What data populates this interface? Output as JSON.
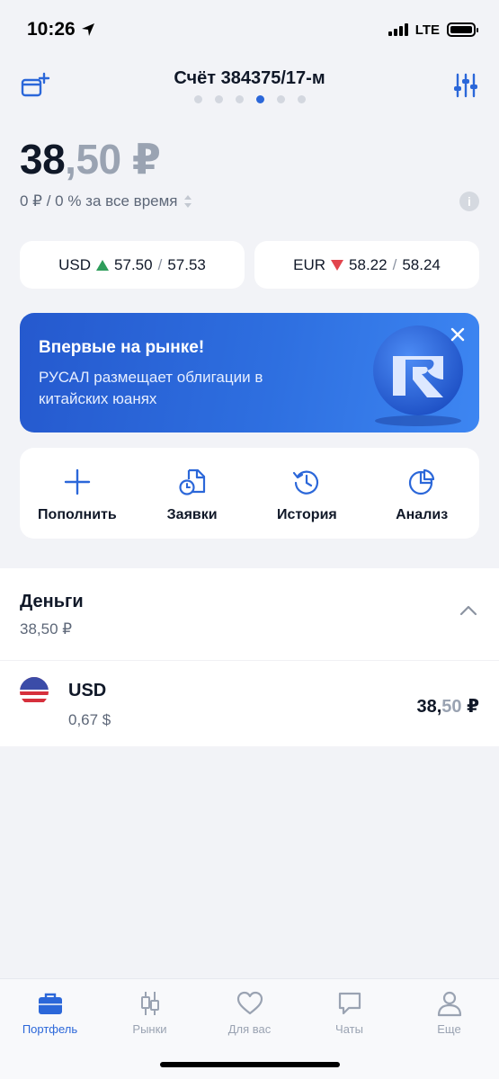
{
  "status": {
    "time": "10:26",
    "network": "LTE"
  },
  "header": {
    "title": "Счёт 384375/17-м",
    "pages": 6,
    "active_page": 3
  },
  "balance": {
    "integer": "38",
    "fraction": ",50 ₽",
    "change": "0 ₽ / 0 % за все время"
  },
  "rates": [
    {
      "currency": "USD",
      "direction": "up",
      "bid": "57.50",
      "ask": "57.53"
    },
    {
      "currency": "EUR",
      "direction": "down",
      "bid": "58.22",
      "ask": "58.24"
    }
  ],
  "banner": {
    "title": "Впервые на рынке!",
    "text": "РУСАЛ размещает облигации в китайских юанях"
  },
  "actions": [
    {
      "label": "Пополнить",
      "icon": "plus-icon"
    },
    {
      "label": "Заявки",
      "icon": "orders-icon"
    },
    {
      "label": "История",
      "icon": "history-icon"
    },
    {
      "label": "Анализ",
      "icon": "pie-chart-icon"
    }
  ],
  "money": {
    "title": "Деньги",
    "total": "38,50 ₽"
  },
  "positions": [
    {
      "name": "USD",
      "quantity": "0,67 $",
      "value_int": "38,",
      "value_frac": "50",
      "value_suffix": " ₽",
      "icon": "us-flag-icon"
    }
  ],
  "tabs": [
    {
      "label": "Портфель",
      "icon": "briefcase-icon",
      "active": true
    },
    {
      "label": "Рынки",
      "icon": "candles-icon",
      "active": false
    },
    {
      "label": "Для вас",
      "icon": "heart-icon",
      "active": false
    },
    {
      "label": "Чаты",
      "icon": "chat-icon",
      "active": false
    },
    {
      "label": "Еще",
      "icon": "profile-icon",
      "active": false
    }
  ],
  "colors": {
    "accent": "#2B67D9",
    "up": "#2E9D5B",
    "down": "#E2444D",
    "background": "#F2F3F7"
  }
}
